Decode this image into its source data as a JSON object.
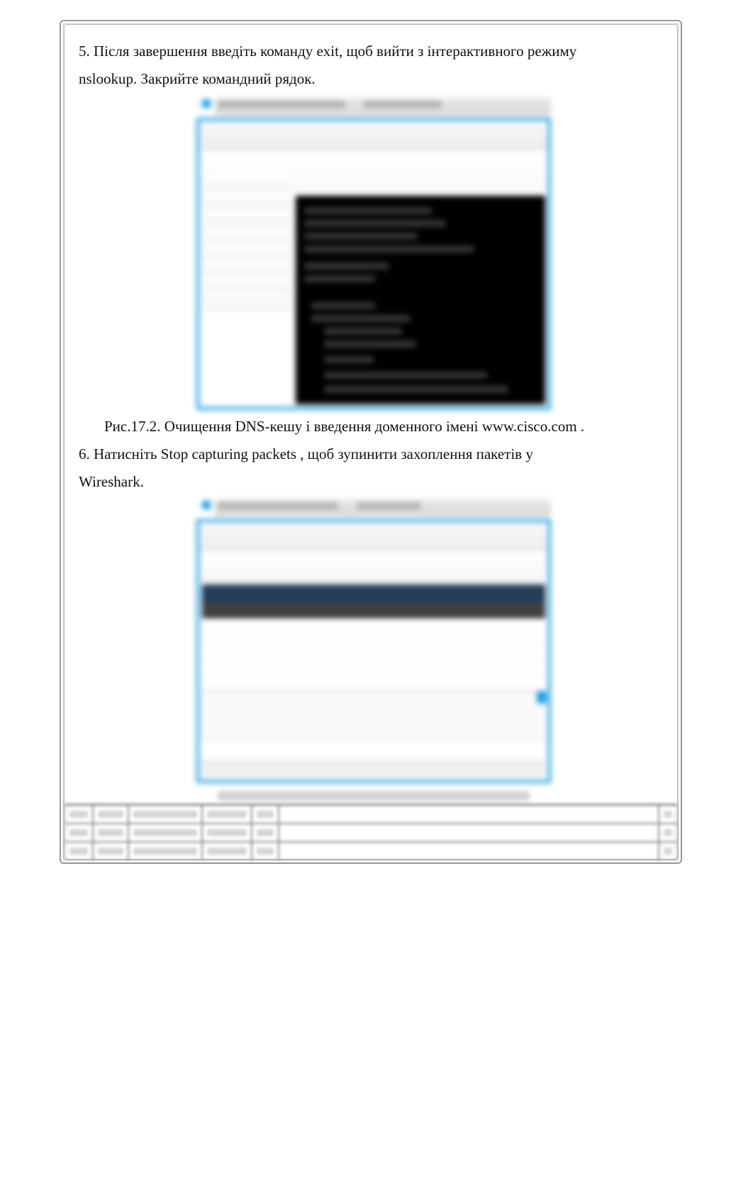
{
  "step5": {
    "line1": "5. Після завершення введіть команду exit, щоб вийти з інтерактивного режиму",
    "line2": "nslookup. Закрийте командний рядок."
  },
  "figure1_caption": "Рис.17.2. Очищення DNS-кешу і введення доменного імені www.cisco.com .",
  "step6": {
    "line1": "6. Натисніть Stop capturing packets   , щоб зупинити захоплення пакетів у",
    "line2": "Wireshark."
  }
}
